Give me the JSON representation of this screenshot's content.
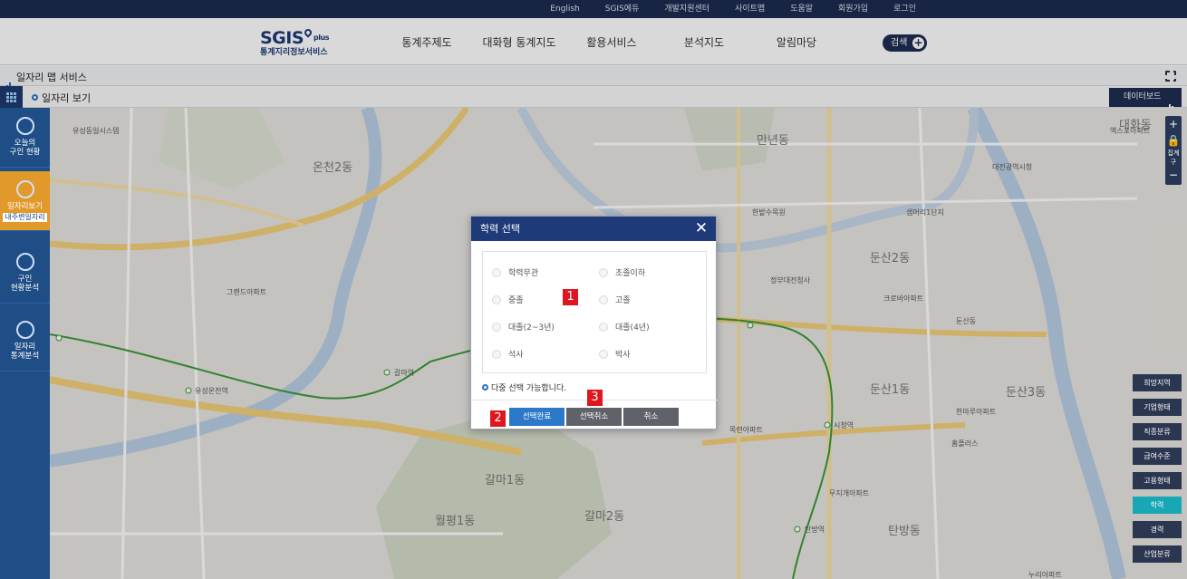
{
  "toplinks": [
    "English",
    "SGIS에듀",
    "개발지원센터",
    "사이트맵",
    "도움말",
    "회원가입",
    "로그인"
  ],
  "logo": {
    "main": "SGIS",
    "plus": "plus",
    "sub": "통계지리정보서비스"
  },
  "gnav": [
    "통계주제도",
    "대화형 통계지도",
    "활용서비스",
    "분석지도",
    "알림마당"
  ],
  "search_label": "검색",
  "app_title": "일자리 맵 서비스",
  "sub_title": "일자리 보기",
  "data_board": "데이터보드",
  "sidebar": [
    {
      "line1": "오늘의",
      "line2": "구인 현황",
      "tag": ""
    },
    {
      "line1": "일자리보기",
      "line2": "",
      "tag": "내주변일자리"
    },
    {
      "line1": "구인",
      "line2": "현황분석",
      "tag": ""
    },
    {
      "line1": "일자리",
      "line2": "통계분석",
      "tag": ""
    }
  ],
  "mapctrl": {
    "zoom_in": "+",
    "unit": "집계구",
    "zoom_out": "−"
  },
  "right_buttons": [
    "희망지역",
    "기업형태",
    "직종분류",
    "급여수준",
    "고용형태",
    "학력",
    "경력",
    "산업분류"
  ],
  "dialog": {
    "title": "학력 선택",
    "options": [
      "학력무관",
      "초졸이하",
      "중졸",
      "고졸",
      "대졸(2~3년)",
      "대졸(4년)",
      "석사",
      "박사"
    ],
    "note": "다중 선택 가능합니다.",
    "buttons": {
      "ok": "선택완료",
      "clear": "선택취소",
      "cancel": "취소"
    }
  },
  "markers": [
    "1",
    "2",
    "3"
  ],
  "map_labels": {
    "districts": [
      "온천2동",
      "만년동",
      "대화동",
      "둔산2동",
      "둔산1동",
      "둔산3동",
      "갈마1동",
      "갈마2동",
      "월평1동",
      "탄방동"
    ],
    "places": [
      "유성동일시스템",
      "그랜드아파트",
      "한밭수목원",
      "정부대전청사",
      "시청역",
      "갈마역",
      "유성온천역",
      "탄방역",
      "둔산동",
      "대전광역시청",
      "샘머리1단지",
      "크로바아파트",
      "한마루아파트",
      "목련아파트",
      "무지개아파트",
      "홈플러스",
      "누리아파트",
      "엑스포아파트"
    ]
  },
  "colors": {
    "primary": "#1e3a78",
    "active": "#e19a2a",
    "teal": "#18a7b5",
    "marker": "#e0161e"
  }
}
